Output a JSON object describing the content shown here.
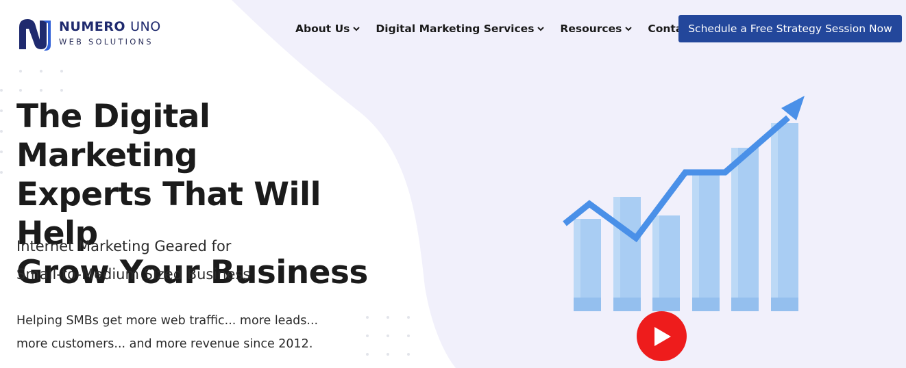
{
  "logo": {
    "word_primary": "NUMERO",
    "word_secondary": "UNO",
    "tagline": "WEB SOLUTIONS",
    "brand_dark": "#1f2a6e",
    "brand_blue": "#2f5fd6"
  },
  "nav": {
    "items": [
      {
        "label": "About Us",
        "has_dropdown": true
      },
      {
        "label": "Digital Marketing Services",
        "has_dropdown": true
      },
      {
        "label": "Resources",
        "has_dropdown": true
      },
      {
        "label": "Contact",
        "has_dropdown": false
      }
    ],
    "chevron_icon": "chevron-down-icon"
  },
  "cta": {
    "label": "Schedule a Free Strategy Session Now",
    "color": "#23479b"
  },
  "hero": {
    "title_lines": [
      "The Digital Marketing",
      "Experts That Will Help",
      "Grow Your Business"
    ],
    "subtitle_lines": [
      "Internet Marketing Geared for",
      "Small-to-Medium Sized Business"
    ],
    "description_lines": [
      "Helping SMBs get more web traffic... more leads...",
      "more customers... and more revenue since 2012."
    ]
  },
  "illustration": {
    "icon": "growth-chart-icon",
    "bar_color": "#a9cdf3",
    "arrow_color": "#4a90e8"
  },
  "video": {
    "icon": "play-icon",
    "color": "#ee1c1c"
  },
  "colors": {
    "blob_background": "#f1f0fb"
  }
}
